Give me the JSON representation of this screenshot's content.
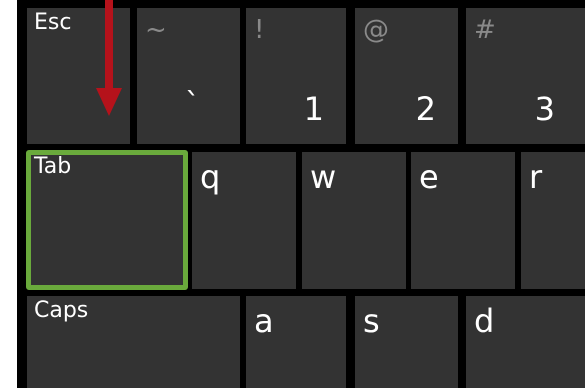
{
  "keyboard": {
    "row1": {
      "esc_label": "Esc",
      "tilde_shift": "~",
      "tilde_main": "`",
      "one_shift": "!",
      "one_main": "1",
      "two_shift": "@",
      "two_main": "2",
      "three_shift": "#",
      "three_main": "3"
    },
    "row2": {
      "tab_label": "Tab",
      "q": "q",
      "w": "w",
      "e": "e",
      "r": "r"
    },
    "row3": {
      "caps_label": "Caps",
      "a": "a",
      "s": "s",
      "d": "d"
    }
  },
  "annotations": {
    "highlighted_key": "Tab",
    "highlight_color": "#6aaa3c",
    "arrow_color": "#b5121b",
    "key_color": "#333333",
    "shift_glyph_color": "#8a8a8a"
  }
}
